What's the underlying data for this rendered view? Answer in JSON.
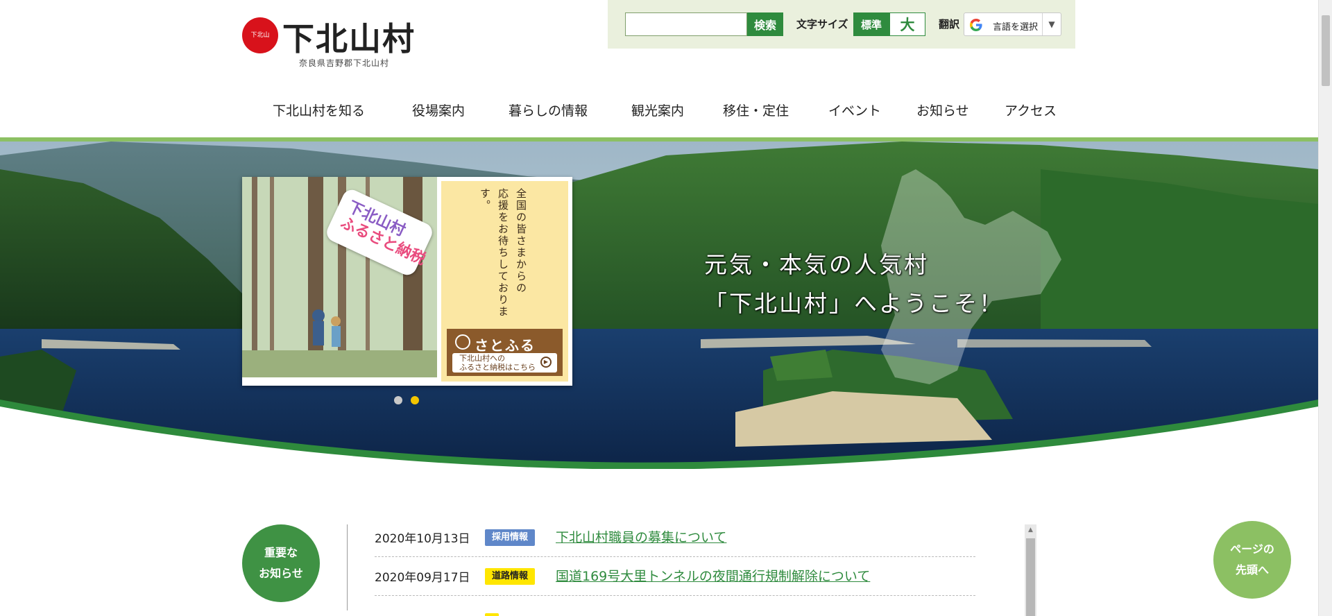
{
  "header": {
    "logo_title": "下北山村",
    "logo_subtitle": "奈良県吉野郡下北山村",
    "logo_seal_text": "下北山"
  },
  "toolbar": {
    "search_value": "",
    "search_button": "検索",
    "font_size_label": "文字サイズ",
    "font_size_standard": "標準",
    "font_size_large": "大",
    "translate_label": "翻訳",
    "translate_select": "言語を選択"
  },
  "nav": {
    "items": [
      {
        "label": "下北山村を知る"
      },
      {
        "label": "役場案内"
      },
      {
        "label": "暮らしの情報"
      },
      {
        "label": "観光案内"
      },
      {
        "label": "移住・定住"
      },
      {
        "label": "イベント"
      },
      {
        "label": "お知らせ"
      },
      {
        "label": "アクセス"
      }
    ]
  },
  "hero": {
    "message_line1": "元気・本気の人気村",
    "message_line2": "「下北山村」へようこそ！",
    "banner": {
      "tag_line1": "下北山村",
      "tag_line2": "ふるさと納税",
      "copy_line1": "全国の皆さまからの",
      "copy_line2": "応援をお待ちしております。",
      "satofuru_logo": "さとふる",
      "satofuru_button_line1": "下北山村への",
      "satofuru_button_line2": "ふるさと納税はこちら"
    },
    "active_slide": 2
  },
  "news": {
    "badge_line1": "重要な",
    "badge_line2": "お知らせ",
    "items": [
      {
        "date": "2020年10月13日",
        "category": "採用情報",
        "title": "下北山村職員の募集について"
      },
      {
        "date": "2020年09月17日",
        "category": "道路情報",
        "title": "国道169号大里トンネルの夜間通行規制解除について"
      }
    ]
  },
  "pagetop": {
    "line1": "ページの",
    "line2": "先頭へ"
  },
  "colors": {
    "brand_green": "#2f8b3e",
    "light_green": "#8cc063",
    "toolbar_bg": "#eaf0dd",
    "recruit_tag": "#5f87c9",
    "road_tag": "#ffe600"
  }
}
